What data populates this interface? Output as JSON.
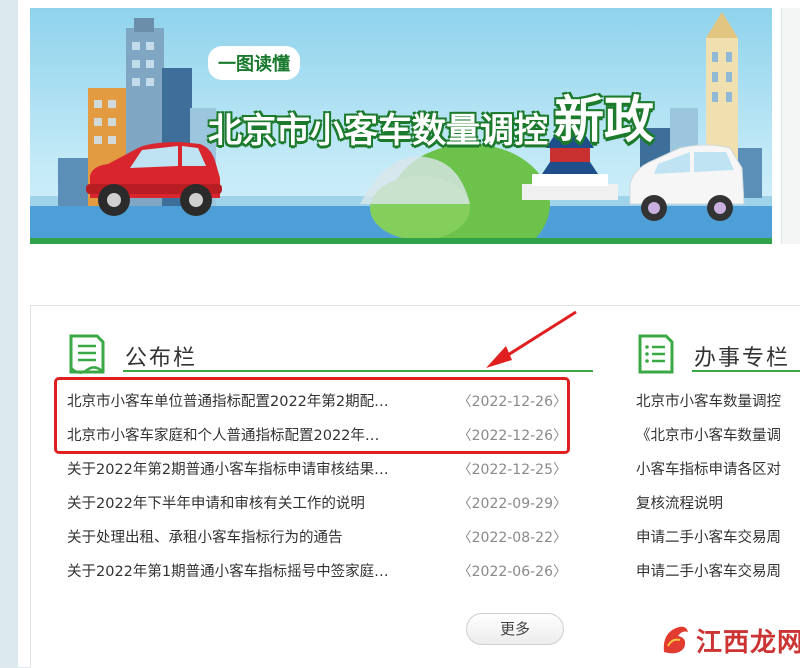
{
  "banner": {
    "tag": "一图读懂",
    "title": "北京市小客车数量调控",
    "title_emphasis": "新政"
  },
  "notice_panel": {
    "title": "公布栏",
    "icon": "document-icon",
    "items": [
      {
        "title": "北京市小客车单位普通指标配置2022年第2期配…",
        "date": "〈2022-12-26〉"
      },
      {
        "title": "北京市小客车家庭和个人普通指标配置2022年…",
        "date": "〈2022-12-26〉"
      },
      {
        "title": "关于2022年第2期普通小客车指标申请审核结果…",
        "date": "〈2022-12-25〉"
      },
      {
        "title": "关于2022年下半年申请和审核有关工作的说明",
        "date": "〈2022-09-29〉"
      },
      {
        "title": "关于处理出租、承租小客车指标行为的通告",
        "date": "〈2022-08-22〉"
      },
      {
        "title": "关于2022年第1期普通小客车指标摇号中签家庭…",
        "date": "〈2022-06-26〉"
      }
    ],
    "more_label": "更多"
  },
  "service_panel": {
    "title": "办事专栏",
    "icon": "list-document-icon",
    "items": [
      {
        "title": "北京市小客车数量调控"
      },
      {
        "title": "《北京市小客车数量调"
      },
      {
        "title": "小客车指标申请各区对"
      },
      {
        "title": "复核流程说明"
      },
      {
        "title": "申请二手小客车交易周"
      },
      {
        "title": "申请二手小客车交易周"
      }
    ]
  },
  "watermark": {
    "text": "江西龙网",
    "icon": "dragon-logo-icon"
  },
  "colors": {
    "accent_green": "#3aa845",
    "highlight_red": "#e02020",
    "date_gray": "#8a8a8a"
  }
}
